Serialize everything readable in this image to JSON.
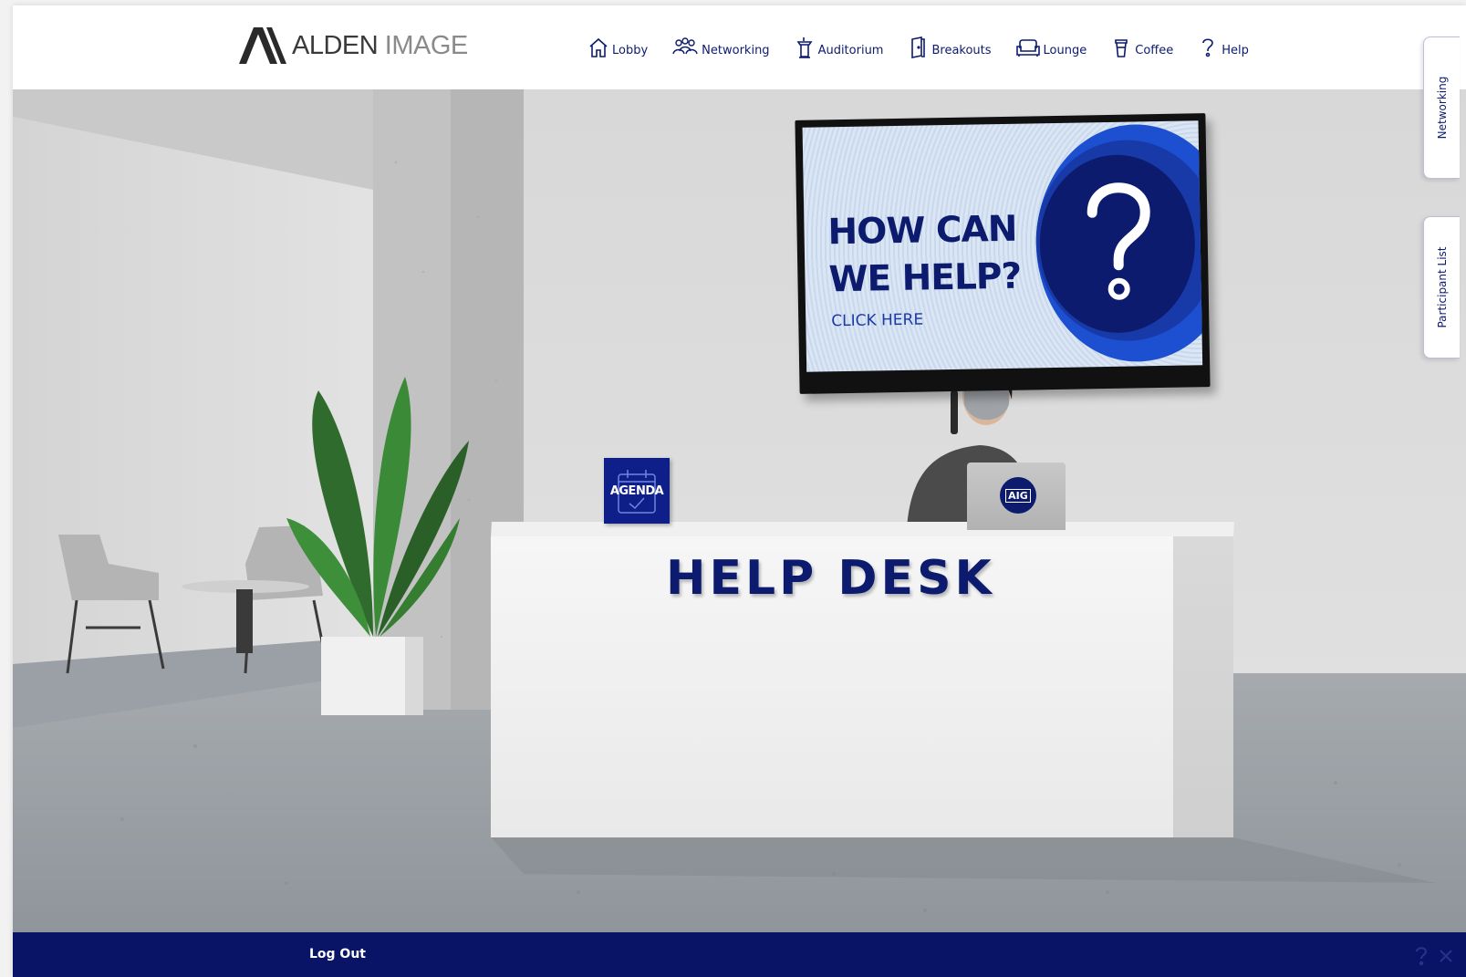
{
  "brand": {
    "name_bold": "ALDEN",
    "name_light": "IMAGE"
  },
  "nav": [
    {
      "label": "Lobby",
      "icon": "home-icon"
    },
    {
      "label": "Networking",
      "icon": "people-icon"
    },
    {
      "label": "Auditorium",
      "icon": "podium-icon"
    },
    {
      "label": "Breakouts",
      "icon": "door-icon"
    },
    {
      "label": "Lounge",
      "icon": "sofa-icon"
    },
    {
      "label": "Coffee",
      "icon": "coffee-cup-icon"
    },
    {
      "label": "Help",
      "icon": "question-icon"
    }
  ],
  "side_tabs": {
    "networking": "Networking",
    "participants": "Participant List"
  },
  "scene": {
    "tv": {
      "line1": "HOW CAN",
      "line2": "WE HELP?",
      "cta": "CLICK HERE"
    },
    "desk_label": "HELP DESK",
    "agenda_label": "AGENDA",
    "laptop_logo": "AIG"
  },
  "footer": {
    "logout": "Log Out"
  },
  "colors": {
    "navy": "#0c1b6e",
    "footer": "#0a1466",
    "accent_blue": "#1d4fd1"
  }
}
